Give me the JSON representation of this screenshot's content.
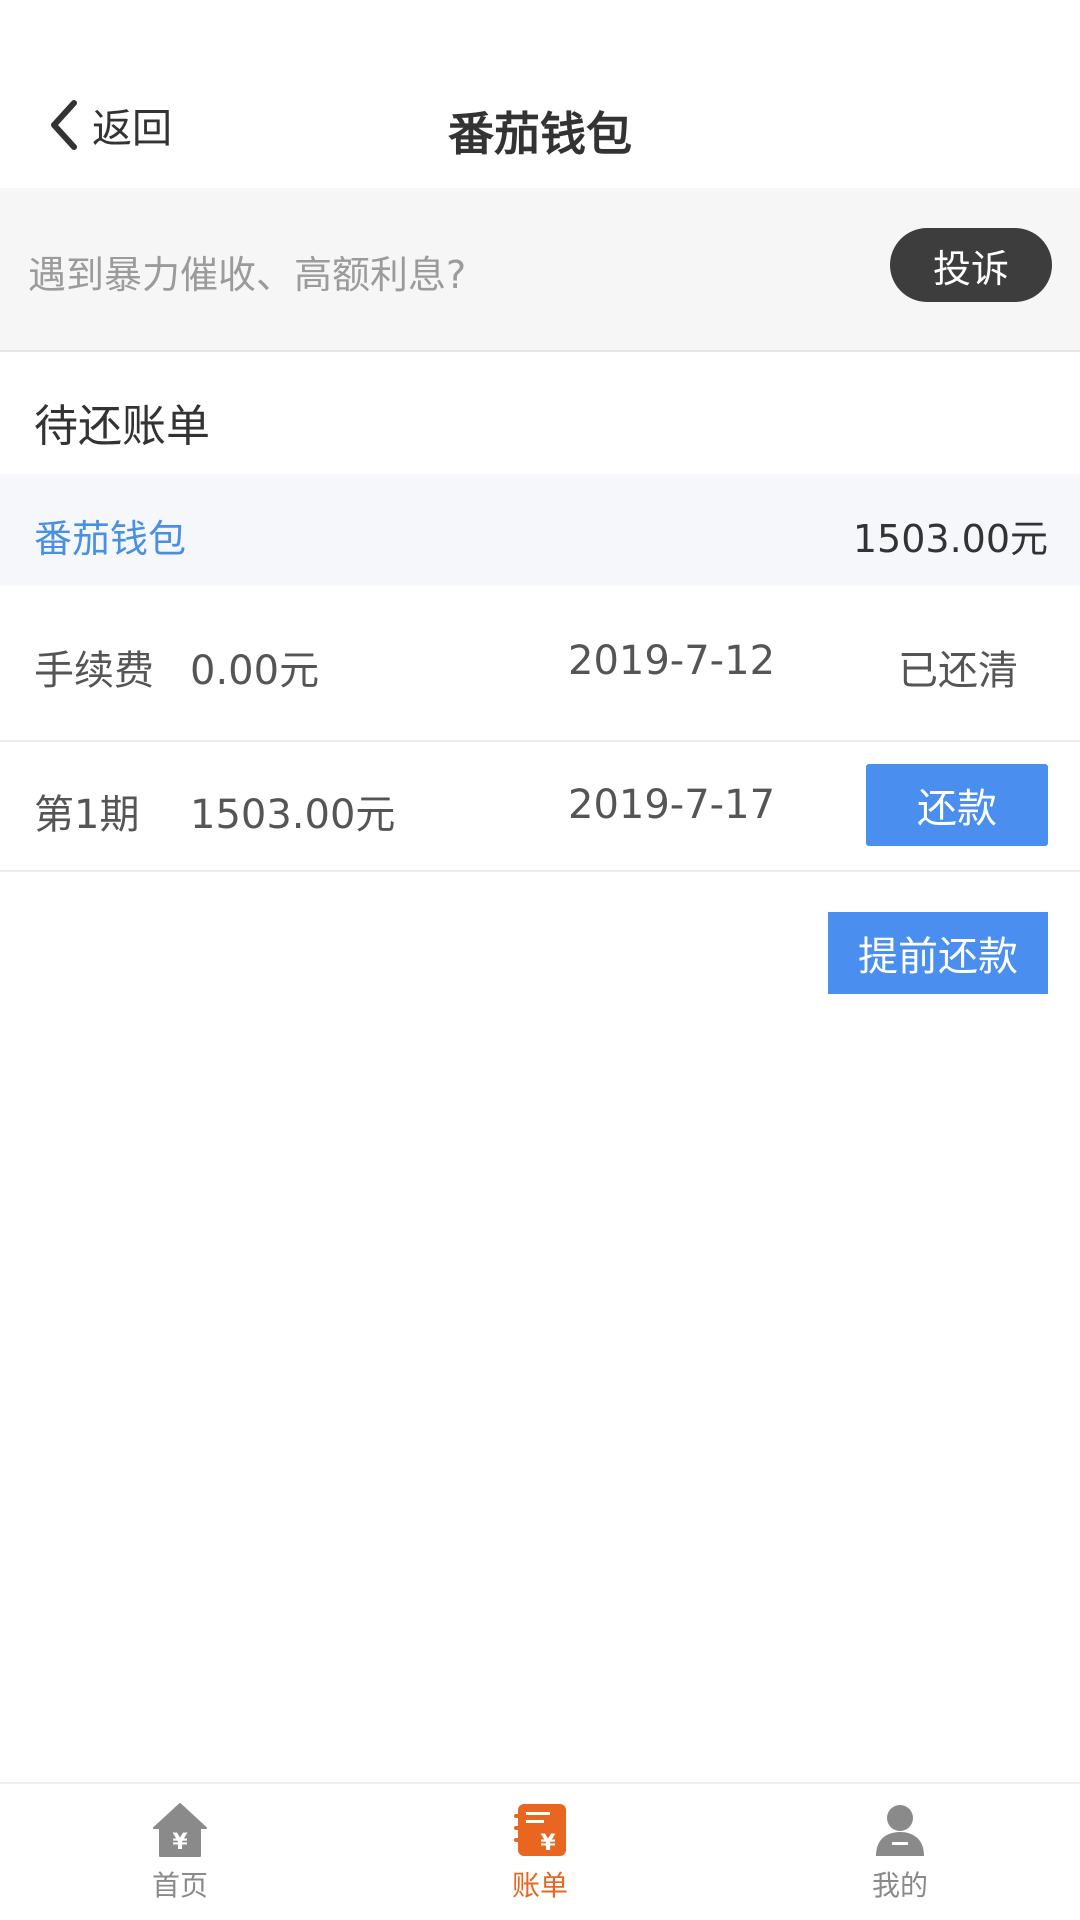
{
  "nav": {
    "back_label": "返回",
    "title": "番茄钱包"
  },
  "banner": {
    "text": "遇到暴力催收、高额利息?",
    "complain_label": "投诉"
  },
  "section": {
    "title": "待还账单"
  },
  "product": {
    "name": "番茄钱包",
    "amount": "1503.00元",
    "name_color": "#4a90e2"
  },
  "bills": [
    {
      "label": "手续费",
      "amount": "0.00元",
      "date": "2019-7-12",
      "status": "已还清"
    },
    {
      "label": "第1期",
      "amount": "1503.00元",
      "date": "2019-7-17",
      "action_label": "还款"
    }
  ],
  "prepay_label": "提前还款",
  "tabs": [
    {
      "label": "首页",
      "icon": "home-yuan-icon",
      "active": false
    },
    {
      "label": "账单",
      "icon": "bill-yuan-icon",
      "active": true
    },
    {
      "label": "我的",
      "icon": "user-icon",
      "active": false
    }
  ],
  "colors": {
    "accent_blue": "#4a8eef",
    "active_tab": "#e8661f",
    "complain_button": "#3d3d3d"
  }
}
